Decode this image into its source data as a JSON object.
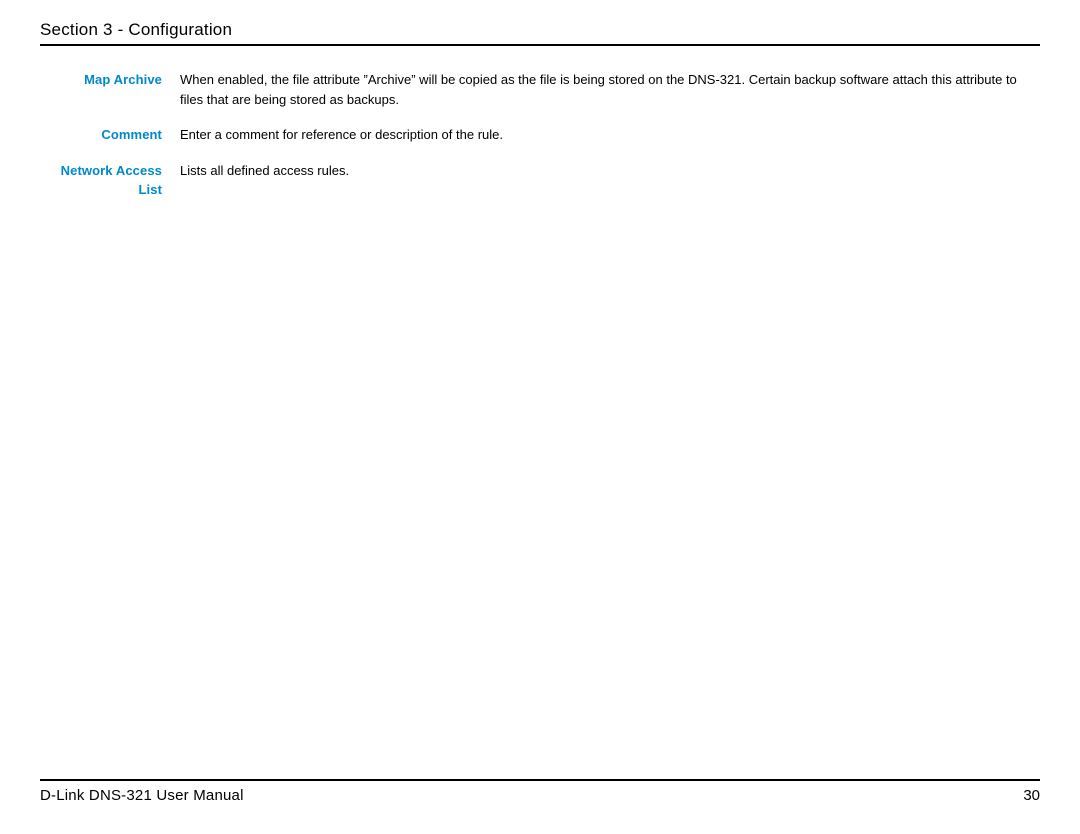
{
  "header": {
    "section_title": "Section 3 - Configuration"
  },
  "definitions": [
    {
      "label": "Map Archive",
      "description": "When enabled, the file attribute ”Archive” will be copied as the file is being stored on the DNS-321. Certain backup software attach this attribute to files that are being stored as backups."
    },
    {
      "label": "Comment",
      "description": "Enter a comment for reference or description of the rule."
    },
    {
      "label": "Network Access List",
      "description": "Lists all defined access rules."
    }
  ],
  "footer": {
    "manual_title": "D-Link DNS-321 User Manual",
    "page_number": "30"
  }
}
